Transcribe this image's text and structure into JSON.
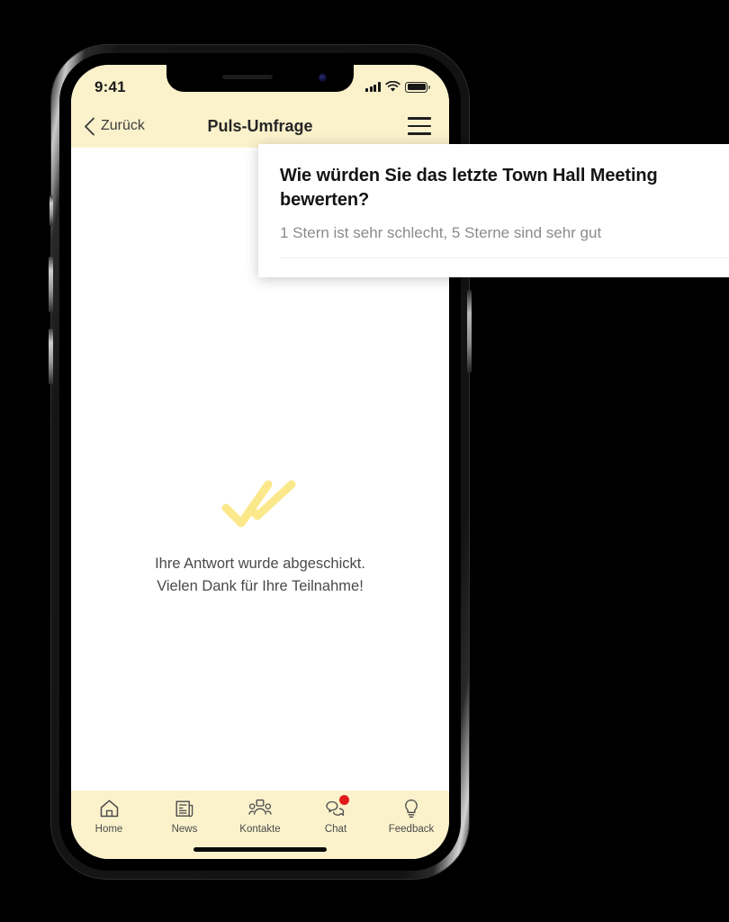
{
  "device": {
    "name": "smartphone-mockup",
    "frame_color": "#1b1b1b"
  },
  "status_bar": {
    "time": "9:41",
    "cellular_icon": "signal-bars-icon",
    "wifi_icon": "wifi-icon",
    "battery_icon": "battery-full-icon",
    "background_color": "#FBF2CC"
  },
  "nav_bar": {
    "back_icon": "chevron-left-icon",
    "back_label": "Zurück",
    "title": "Puls-Umfrage",
    "menu_icon": "hamburger-menu-icon"
  },
  "content": {
    "success_icon": "double-check-icon",
    "success_icon_color": "#FBE88A",
    "confirmation_line1": "Ihre Antwort wurde abgeschickt.",
    "confirmation_line2": "Vielen Dank für Ihre Teilnahme!"
  },
  "survey_card": {
    "question": "Wie würden Sie das letzte Town Hall Meeting bewerten?",
    "subtitle": "1 Stern ist sehr schlecht, 5 Sterne sind sehr gut"
  },
  "tab_bar": {
    "background_color": "#FBF2CC",
    "badge_color": "#E01B1B",
    "items": [
      {
        "label": "Home",
        "icon": "home-icon",
        "badge": false
      },
      {
        "label": "News",
        "icon": "news-icon",
        "badge": false
      },
      {
        "label": "Kontakte",
        "icon": "contacts-icon",
        "badge": false
      },
      {
        "label": "Chat",
        "icon": "chat-icon",
        "badge": true
      },
      {
        "label": "Feedback",
        "icon": "lightbulb-icon",
        "badge": false
      }
    ]
  },
  "home_indicator": {
    "icon": "home-indicator-bar"
  }
}
